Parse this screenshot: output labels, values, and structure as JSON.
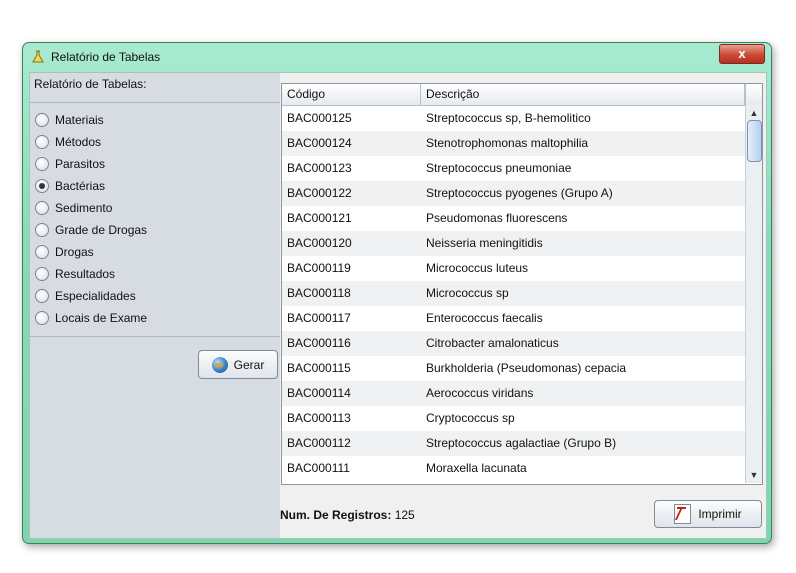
{
  "window": {
    "title": "Relatório de Tabelas",
    "close_symbol": "x"
  },
  "left_panel": {
    "title": "Relatório de Tabelas:",
    "options": [
      {
        "label": "Materiais",
        "selected": false
      },
      {
        "label": "Métodos",
        "selected": false
      },
      {
        "label": "Parasitos",
        "selected": false
      },
      {
        "label": "Bactérias",
        "selected": true
      },
      {
        "label": "Sedimento",
        "selected": false
      },
      {
        "label": "Grade de Drogas",
        "selected": false
      },
      {
        "label": "Drogas",
        "selected": false
      },
      {
        "label": "Resultados",
        "selected": false
      },
      {
        "label": "Especialidades",
        "selected": false
      },
      {
        "label": "Locais de Exame",
        "selected": false
      }
    ],
    "gerar_label": "Gerar",
    "gerar_icon": "globe-icon"
  },
  "table": {
    "headers": [
      "Código",
      "Descrição"
    ],
    "rows": [
      [
        "BAC000125",
        "Streptococcus sp, B-hemolitico"
      ],
      [
        "BAC000124",
        "Stenotrophomonas maltophilia"
      ],
      [
        "BAC000123",
        "Streptococcus pneumoniae"
      ],
      [
        "BAC000122",
        "Streptococcus pyogenes (Grupo A)"
      ],
      [
        "BAC000121",
        "Pseudomonas fluorescens"
      ],
      [
        "BAC000120",
        "Neisseria meningitidis"
      ],
      [
        "BAC000119",
        "Micrococcus luteus"
      ],
      [
        "BAC000118",
        "Micrococcus sp"
      ],
      [
        "BAC000117",
        "Enterococcus faecalis"
      ],
      [
        "BAC000116",
        "Citrobacter amalonaticus"
      ],
      [
        "BAC000115",
        "Burkholderia (Pseudomonas) cepacia"
      ],
      [
        "BAC000114",
        "Aerococcus viridans"
      ],
      [
        "BAC000113",
        "Cryptococcus sp"
      ],
      [
        "BAC000112",
        "Streptococcus agalactiae (Grupo B)"
      ],
      [
        "BAC000111",
        "Moraxella lacunata"
      ]
    ]
  },
  "footer": {
    "count_label": "Num. De Registros:",
    "count_value": "125",
    "imprimir_label": "Imprimir",
    "imprimir_icon": "pdf-icon"
  }
}
